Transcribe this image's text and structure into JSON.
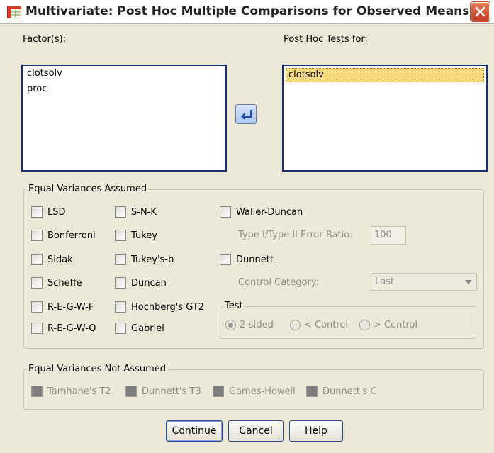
{
  "window": {
    "title": "Multivariate: Post Hoc Multiple Comparisons for Observed Means",
    "icon": "spss-table-icon",
    "close_icon": "close-icon"
  },
  "factors": {
    "label": "Factor(s):",
    "items": [
      "clotsolv",
      "proc"
    ]
  },
  "post_hoc": {
    "label": "Post Hoc Tests for:",
    "items": [
      "clotsolv"
    ]
  },
  "move_button": {
    "icon": "arrow-move-icon"
  },
  "equal_variances": {
    "legend": "Equal Variances Assumed",
    "col1": [
      "LSD",
      "Bonferroni",
      "Sidak",
      "Scheffe",
      "R-E-G-W-F",
      "R-E-G-W-Q"
    ],
    "col2": [
      "S-N-K",
      "Tukey",
      "Tukey's-b",
      "Duncan",
      "Hochberg's GT2",
      "Gabriel"
    ],
    "waller": "Waller-Duncan",
    "error_ratio_label": "Type I/Type II Error Ratio:",
    "error_ratio_value": "100",
    "dunnett": "Dunnett",
    "control_category_label": "Control Category:",
    "control_category_value": "Last",
    "test": {
      "legend": "Test",
      "options": [
        "2-sided",
        "< Control",
        "> Control"
      ],
      "selected": "2-sided"
    }
  },
  "unequal_variances": {
    "legend": "Equal Variances Not Assumed",
    "items": [
      "Tamhane's T2",
      "Dunnett's T3",
      "Games-Howell",
      "Dunnett's C"
    ]
  },
  "buttons": {
    "continue": "Continue",
    "cancel": "Cancel",
    "help": "Help"
  },
  "colors": {
    "selection": "#f7d97e",
    "listbox_border": "#1a2f6e",
    "dialog_bg": "#ece9d8"
  }
}
